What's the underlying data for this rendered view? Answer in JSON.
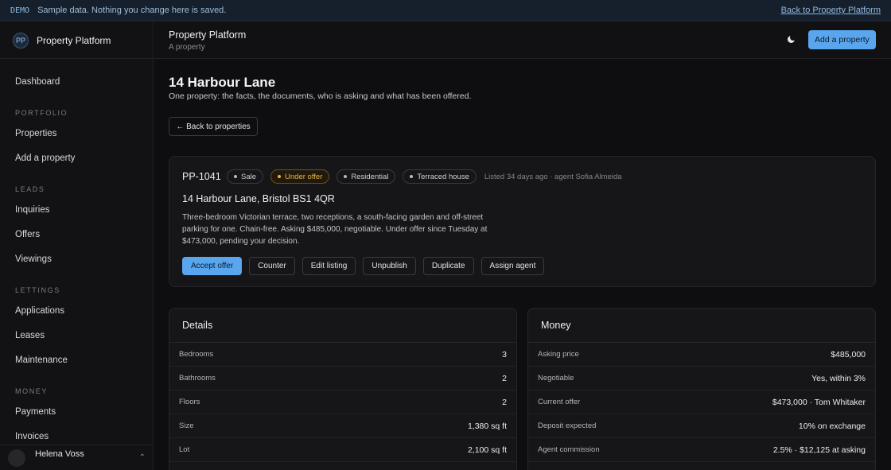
{
  "banner": {
    "tag": "DEMO",
    "message": "Sample data. Nothing you change here is saved.",
    "back_link": "Back to Property Platform"
  },
  "sidebar": {
    "logo_initials": "PP",
    "app_name": "Property Platform",
    "dashboard": "Dashboard",
    "sections": [
      {
        "title": "PORTFOLIO",
        "items": [
          "Properties",
          "Add a property"
        ]
      },
      {
        "title": "LEADS",
        "items": [
          "Inquiries",
          "Offers",
          "Viewings"
        ]
      },
      {
        "title": "LETTINGS",
        "items": [
          "Applications",
          "Leases",
          "Maintenance"
        ]
      },
      {
        "title": "MONEY",
        "items": [
          "Payments",
          "Invoices"
        ]
      }
    ],
    "user_name": "Helena Voss"
  },
  "topbar": {
    "title": "Property Platform",
    "subtitle": "A property",
    "add_button": "Add a property"
  },
  "page": {
    "title": "14 Harbour Lane",
    "subtitle": "One property: the facts, the documents, who is asking and what has been offered.",
    "back_button": "← Back to properties"
  },
  "property": {
    "ref": "PP-1041",
    "chips": [
      "Sale",
      "Under offer",
      "Residential",
      "Terraced house"
    ],
    "listed": "Listed 34 days ago · agent Sofia Almeida",
    "address": "14 Harbour Lane, Bristol BS1 4QR",
    "description": "Three-bedroom Victorian terrace, two receptions, a south-facing garden and off-street parking for one. Chain-free. Asking $485,000, negotiable. Under offer since Tuesday at $473,000, pending your decision.",
    "actions": [
      "Accept offer",
      "Counter",
      "Edit listing",
      "Unpublish",
      "Duplicate",
      "Assign agent"
    ]
  },
  "details": {
    "title": "Details",
    "rows": [
      {
        "k": "Bedrooms",
        "v": "3"
      },
      {
        "k": "Bathrooms",
        "v": "2"
      },
      {
        "k": "Floors",
        "v": "2"
      },
      {
        "k": "Size",
        "v": "1,380 sq ft"
      },
      {
        "k": "Lot",
        "v": "2,100 sq ft"
      }
    ]
  },
  "money": {
    "title": "Money",
    "rows": [
      {
        "k": "Asking price",
        "v": "$485,000"
      },
      {
        "k": "Negotiable",
        "v": "Yes, within 3%"
      },
      {
        "k": "Current offer",
        "v": "$473,000 · Tom Whitaker"
      },
      {
        "k": "Deposit expected",
        "v": "10% on exchange"
      },
      {
        "k": "Agent commission",
        "v": "2.5% · $12,125 at asking"
      }
    ]
  },
  "colors": {
    "accent": "#5aa6ee",
    "warning": "#e5b34a",
    "background": "#0e0e10"
  }
}
